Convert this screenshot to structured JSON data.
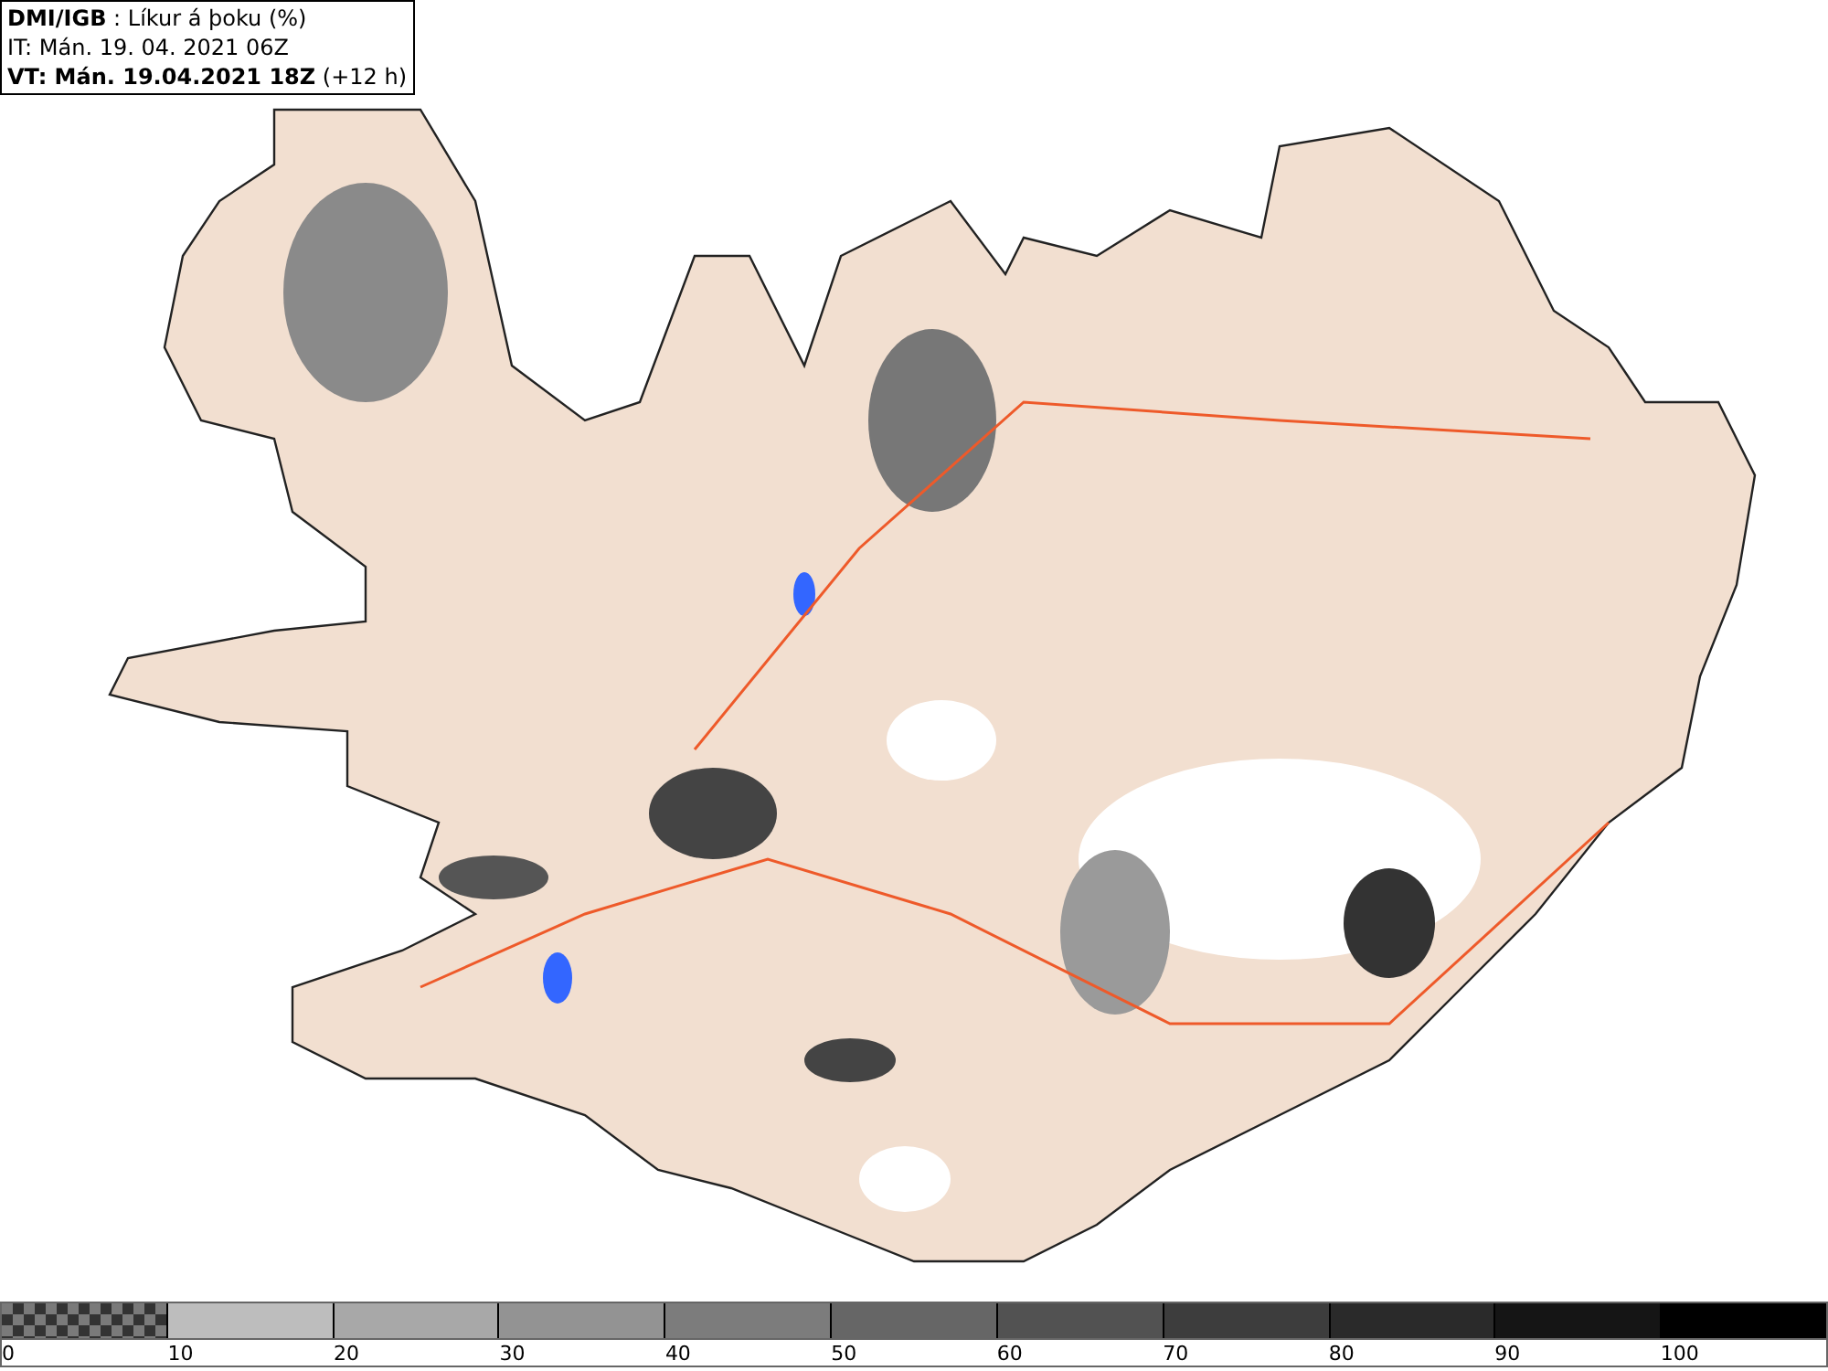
{
  "header": {
    "lines": [
      "**DMI/IGB** : Líkur á þoku (%)",
      "IT: Mán. 19. 04. 2021 06Z",
      "**VT: Mán. 19.04.2021 18Z** (+12 h)"
    ]
  },
  "legend": [
    {
      "label": "0",
      "color": "#7a7a7a",
      "kind": "checker"
    },
    {
      "label": "10",
      "color": "#bdbdbd",
      "kind": "solid"
    },
    {
      "label": "20",
      "color": "#a8a8a8",
      "kind": "solid"
    },
    {
      "label": "30",
      "color": "#939393",
      "kind": "solid"
    },
    {
      "label": "40",
      "color": "#7c7c7c",
      "kind": "solid"
    },
    {
      "label": "50",
      "color": "#666666",
      "kind": "solid"
    },
    {
      "label": "60",
      "color": "#525252",
      "kind": "solid"
    },
    {
      "label": "70",
      "color": "#3d3d3d",
      "kind": "solid"
    },
    {
      "label": "80",
      "color": "#2a2a2a",
      "kind": "solid"
    },
    {
      "label": "90",
      "color": "#151515",
      "kind": "solid"
    },
    {
      "label": "100",
      "color": "#000000",
      "kind": "solid"
    }
  ]
}
